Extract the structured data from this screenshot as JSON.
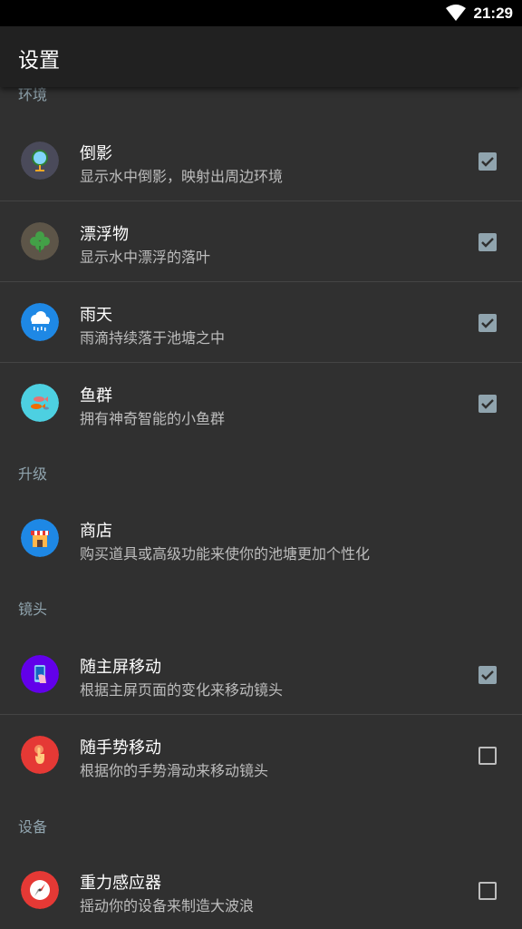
{
  "status_bar": {
    "time": "21:29",
    "wifi_icon": "wifi-icon"
  },
  "app_bar": {
    "title": "设置"
  },
  "sections": {
    "environment": "环境",
    "upgrade": "升级",
    "camera": "镜头",
    "device": "设备"
  },
  "items": {
    "reflection": {
      "title": "倒影",
      "summary": "显示水中倒影，映射出周边环境",
      "checked": true,
      "icon": "mirror-icon",
      "icon_color": "#4a4a5a"
    },
    "floating": {
      "title": "漂浮物",
      "summary": "显示水中漂浮的落叶",
      "checked": true,
      "icon": "clover-icon",
      "icon_color": "#5d5548"
    },
    "rain": {
      "title": "雨天",
      "summary": "雨滴持续落于池塘之中",
      "checked": true,
      "icon": "rain-cloud-icon",
      "icon_color": "#1e88e5"
    },
    "fish": {
      "title": "鱼群",
      "summary": "拥有神奇智能的小鱼群",
      "checked": true,
      "icon": "fish-icon",
      "icon_color": "#4dd0e1"
    },
    "shop": {
      "title": "商店",
      "summary": "购买道具或高级功能来使你的池塘更加个性化",
      "icon": "shop-icon",
      "icon_color": "#1e88e5"
    },
    "follow_home": {
      "title": "随主屏移动",
      "summary": "根据主屏页面的变化来移动镜头",
      "checked": true,
      "icon": "phone-swipe-icon",
      "icon_color": "#6200ea"
    },
    "follow_gesture": {
      "title": "随手势移动",
      "summary": "根据你的手势滑动来移动镜头",
      "checked": false,
      "icon": "touch-icon",
      "icon_color": "#e53935"
    },
    "gravity": {
      "title": "重力感应器",
      "summary": "摇动你的设备来制造大波浪",
      "checked": false,
      "icon": "compass-icon",
      "icon_color": "#e53935"
    }
  },
  "colors": {
    "checkbox_checked": "#90a4ae",
    "section_header": "#90a4ae",
    "background": "#303030",
    "app_bar": "#212121"
  }
}
